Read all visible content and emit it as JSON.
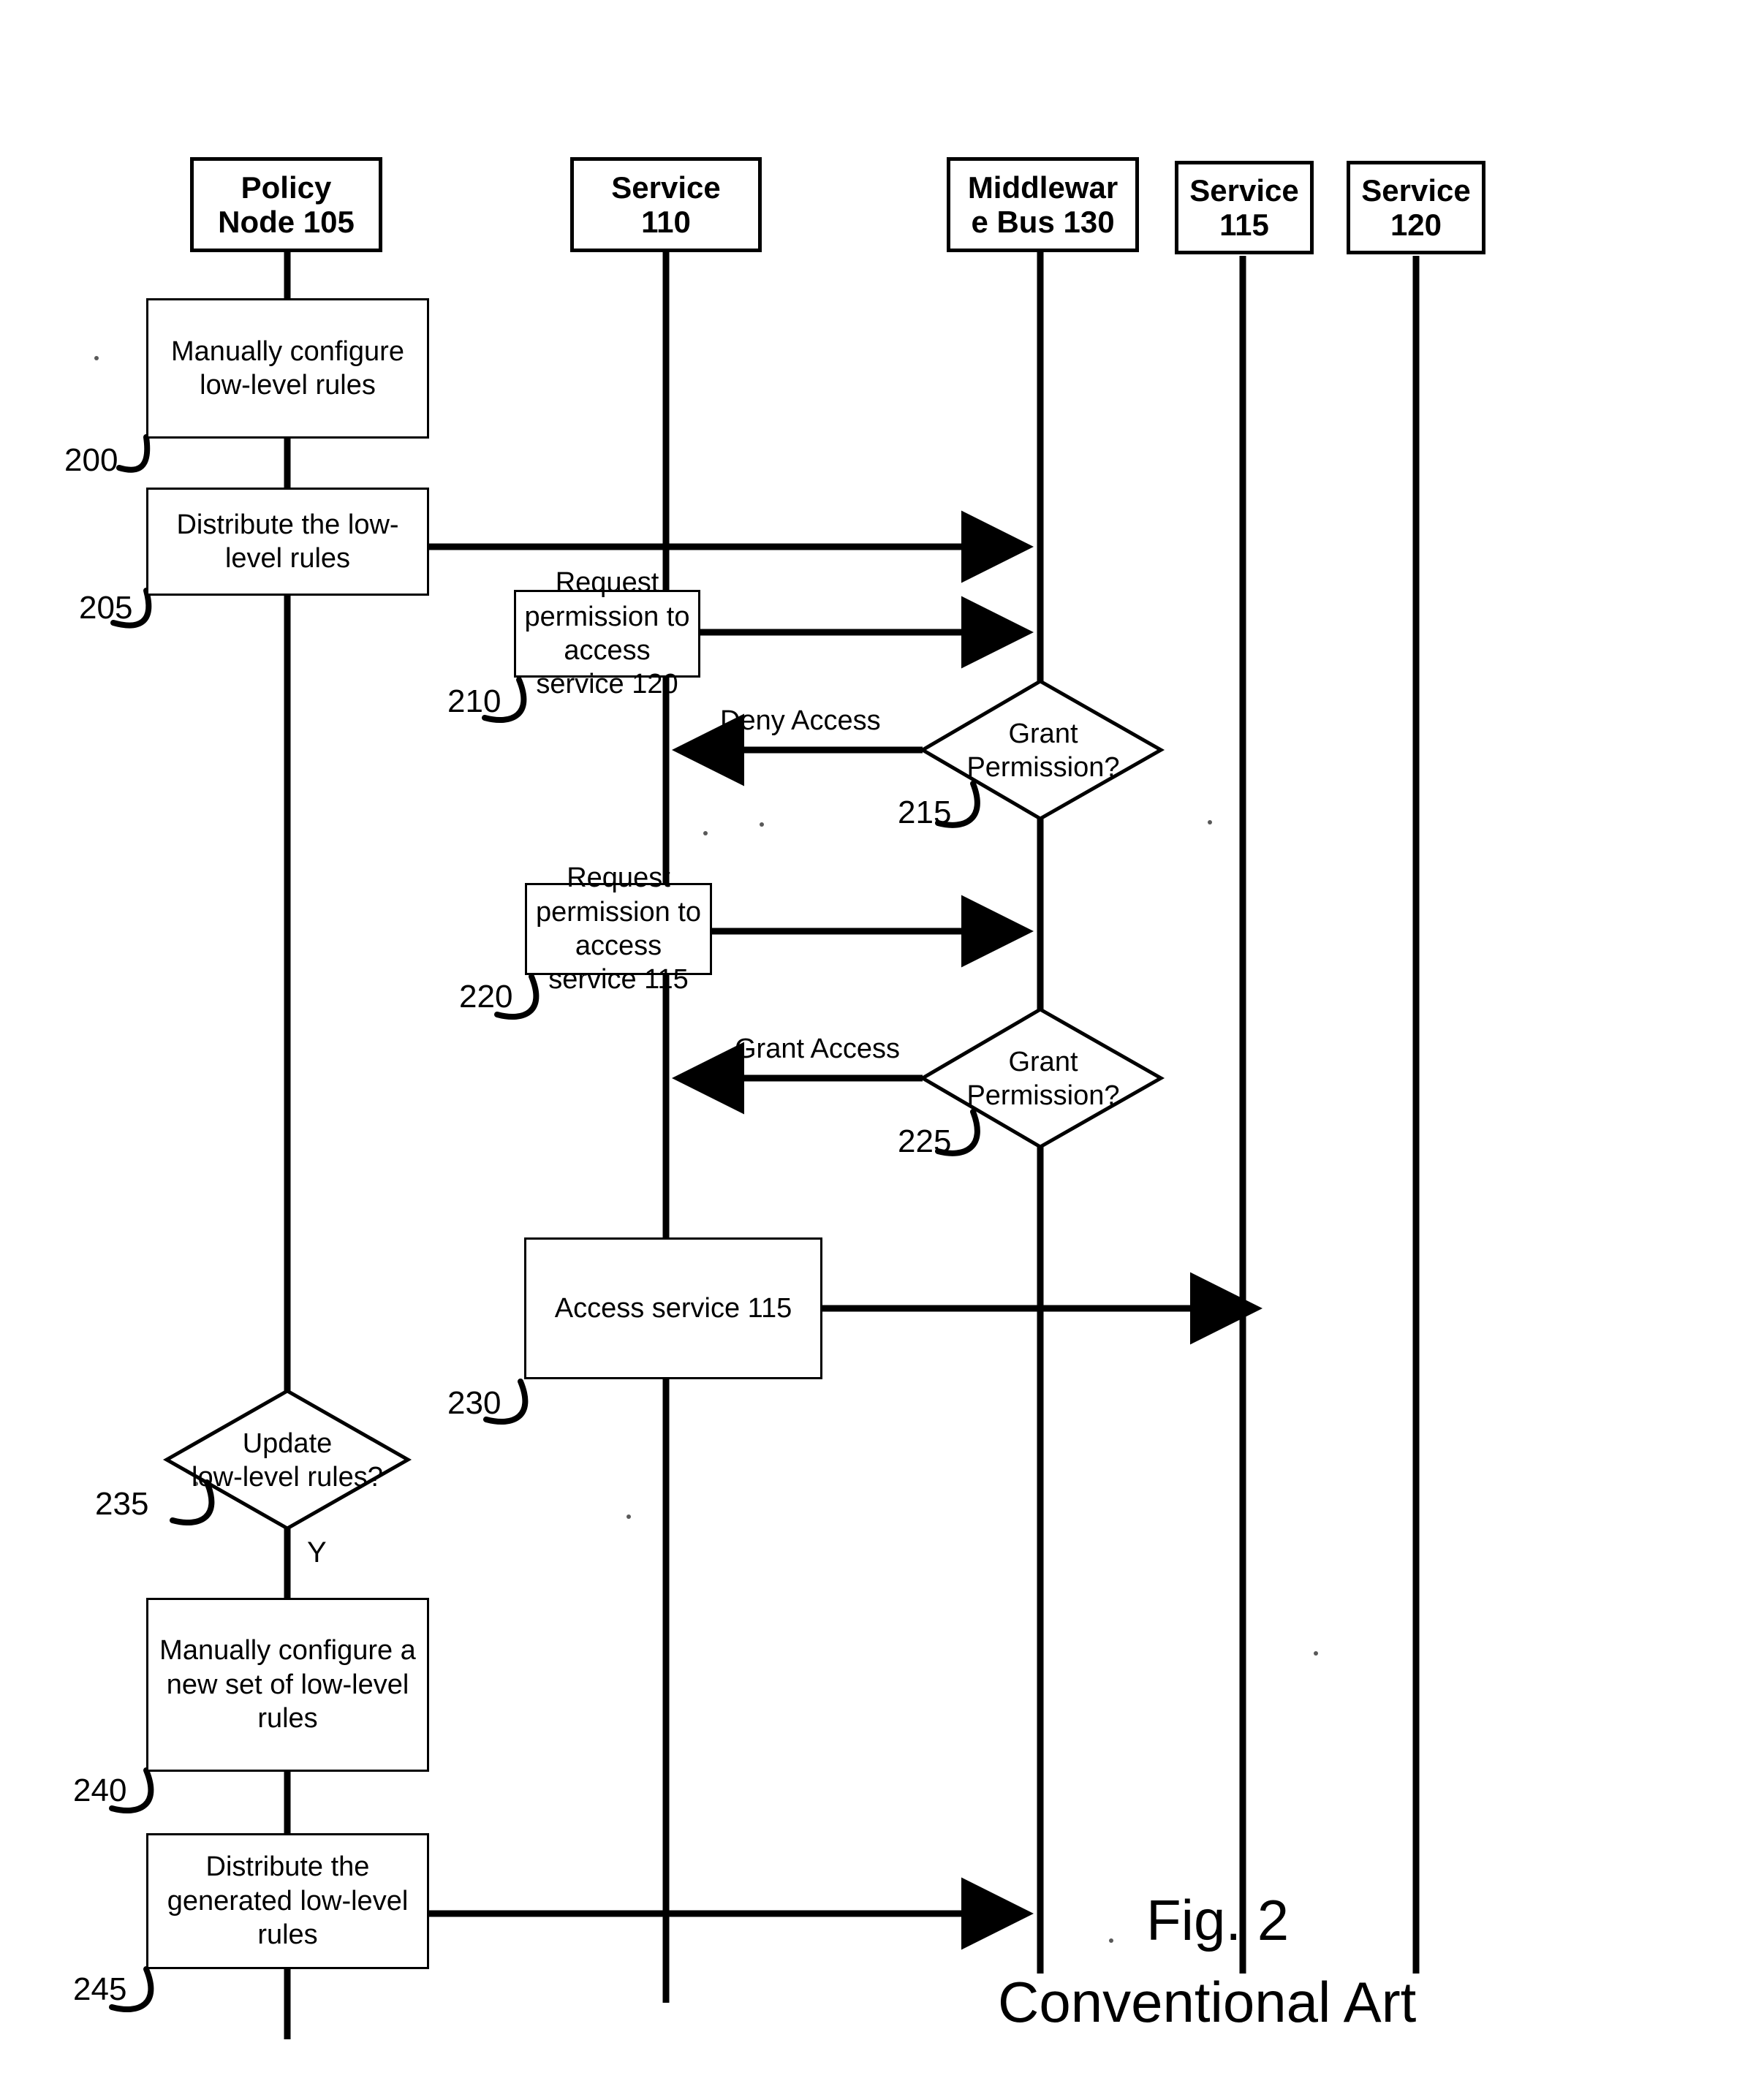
{
  "figure": {
    "title": "Fig. 2",
    "subtitle": "Conventional Art"
  },
  "lanes": [
    {
      "id": "policy-node",
      "line1": "Policy",
      "line2": "Node 105"
    },
    {
      "id": "service-110",
      "line1": "Service",
      "line2": "110"
    },
    {
      "id": "middleware-bus",
      "line1": "Middlewar",
      "line2": "e Bus 130"
    },
    {
      "id": "service-115",
      "line1": "Service",
      "line2": "115"
    },
    {
      "id": "service-120",
      "line1": "Service",
      "line2": "120"
    }
  ],
  "steps": [
    {
      "ref": "200",
      "label": "Manually configure low-level rules",
      "lane": "policy-node",
      "shape": "process"
    },
    {
      "ref": "205",
      "label": "Distribute the low-level rules",
      "lane": "policy-node",
      "shape": "process"
    },
    {
      "ref": "210",
      "label": "Request permission to access service 120",
      "lane": "service-110",
      "shape": "process"
    },
    {
      "ref": "215",
      "label": "Grant Permission?",
      "lane": "middleware-bus",
      "shape": "decision"
    },
    {
      "ref": "220",
      "label": "Request permission to access service 115",
      "lane": "service-110",
      "shape": "process"
    },
    {
      "ref": "225",
      "label": "Grant Permission?",
      "lane": "middleware-bus",
      "shape": "decision"
    },
    {
      "ref": "230",
      "label": "Access service 115",
      "lane": "service-110",
      "shape": "process"
    },
    {
      "ref": "235",
      "label": "Update low-level rules?",
      "lane": "policy-node",
      "shape": "decision"
    },
    {
      "ref": "240",
      "label": "Manually configure a new set of low-level rules",
      "lane": "policy-node",
      "shape": "process"
    },
    {
      "ref": "245",
      "label": "Distribute the generated low-level rules",
      "lane": "policy-node",
      "shape": "process"
    }
  ],
  "step_text": {
    "s200": "Manually configure low-level rules",
    "s205": "Distribute the low-level rules",
    "s210": "Request permission to access service 120",
    "s215_l1": "Grant",
    "s215_l2": "Permission?",
    "s220": "Request permission to access service 115",
    "s225_l1": "Grant",
    "s225_l2": "Permission?",
    "s230": "Access service 115",
    "s235_l1": "Update",
    "s235_l2": "low-level rules?",
    "s240": "Manually configure a new set of low-level rules",
    "s245": "Distribute the generated low-level rules"
  },
  "refs": {
    "r200": "200",
    "r205": "205",
    "r210": "210",
    "r215": "215",
    "r220": "220",
    "r225": "225",
    "r230": "230",
    "r235": "235",
    "r240": "240",
    "r245": "245"
  },
  "edge_labels": {
    "deny_access": "Deny Access",
    "grant_access": "Grant Access",
    "yes_branch": "Y"
  },
  "colors": {
    "stroke": "#000000",
    "background": "#ffffff"
  }
}
